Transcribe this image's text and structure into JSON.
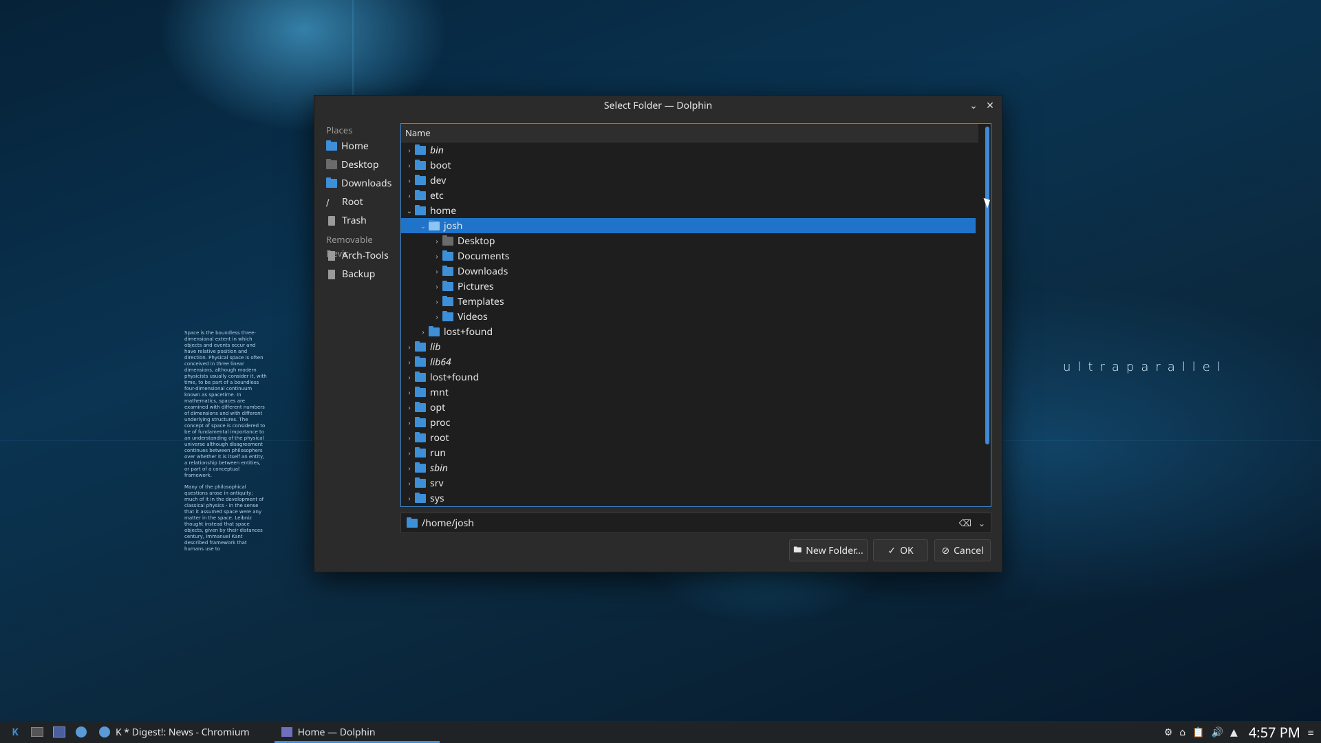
{
  "wallpaper": {
    "text": "ultraparallel",
    "paragraph1": "Space is the boundless three-dimensional extent in which objects and events occur and have relative position and direction. Physical space is often conceived in three linear dimensions, although modern physicists usually consider it, with time, to be part of a boundless four-dimensional continuum known as spacetime. In mathematics, spaces are examined with different numbers of dimensions and with different underlying structures. The concept of space is considered to be of fundamental importance to an understanding of the physical universe although disagreement continues between philosophers over whether it is itself an entity, a relationship between entities, or part of a conceptual framework.",
    "paragraph2": "Many of the philosophical questions arose in antiquity; much of it in the development of classical physics - in the sense that it assumed space were any matter in the space. Leibniz thought instead that space objects, given by their distances century, Immanuel Kant described framework that humans use to"
  },
  "dialog": {
    "title": "Select Folder — Dolphin",
    "places_header": "Places",
    "places": [
      {
        "label": "Home",
        "icon": "home-folder-icon"
      },
      {
        "label": "Desktop",
        "icon": "desktop-icon"
      },
      {
        "label": "Downloads",
        "icon": "downloads-folder-icon"
      },
      {
        "label": "Root",
        "icon": "root-icon"
      },
      {
        "label": "Trash",
        "icon": "trash-icon"
      }
    ],
    "removable_header": "Removable Devic",
    "devices": [
      {
        "label": "Arch-Tools",
        "icon": "drive-icon"
      },
      {
        "label": "Backup",
        "icon": "drive-icon"
      }
    ],
    "column_header": "Name",
    "tree": [
      {
        "label": "bin",
        "level": 0,
        "arrow": "›",
        "italic": true
      },
      {
        "label": "boot",
        "level": 0,
        "arrow": "›"
      },
      {
        "label": "dev",
        "level": 0,
        "arrow": "›"
      },
      {
        "label": "etc",
        "level": 0,
        "arrow": "›"
      },
      {
        "label": "home",
        "level": 0,
        "arrow": "⌄"
      },
      {
        "label": "josh",
        "level": 1,
        "arrow": "⌄",
        "selected": true
      },
      {
        "label": "Desktop",
        "level": 2,
        "arrow": "›",
        "grey": true
      },
      {
        "label": "Documents",
        "level": 2,
        "arrow": "›"
      },
      {
        "label": "Downloads",
        "level": 2,
        "arrow": "›"
      },
      {
        "label": "Pictures",
        "level": 2,
        "arrow": "›"
      },
      {
        "label": "Templates",
        "level": 2,
        "arrow": "›"
      },
      {
        "label": "Videos",
        "level": 2,
        "arrow": "›"
      },
      {
        "label": "lost+found",
        "level": 1,
        "arrow": "›"
      },
      {
        "label": "lib",
        "level": 0,
        "arrow": "›",
        "italic": true
      },
      {
        "label": "lib64",
        "level": 0,
        "arrow": "›",
        "italic": true
      },
      {
        "label": "lost+found",
        "level": 0,
        "arrow": "›"
      },
      {
        "label": "mnt",
        "level": 0,
        "arrow": "›"
      },
      {
        "label": "opt",
        "level": 0,
        "arrow": "›"
      },
      {
        "label": "proc",
        "level": 0,
        "arrow": "›"
      },
      {
        "label": "root",
        "level": 0,
        "arrow": "›"
      },
      {
        "label": "run",
        "level": 0,
        "arrow": "›"
      },
      {
        "label": "sbin",
        "level": 0,
        "arrow": "›",
        "italic": true
      },
      {
        "label": "srv",
        "level": 0,
        "arrow": "›"
      },
      {
        "label": "sys",
        "level": 0,
        "arrow": "›"
      }
    ],
    "path": "/home/josh",
    "buttons": {
      "new_folder": "New Folder...",
      "ok": "OK",
      "cancel": "Cancel"
    }
  },
  "taskbar": {
    "tasks": [
      {
        "label": "K * Digest!: News - Chromium",
        "active": false
      },
      {
        "label": "Home — Dolphin",
        "active": true
      }
    ],
    "clock": "4:57 PM"
  },
  "colors": {
    "accent": "#1f73c9",
    "dialog_bg": "#2b2b2b",
    "folder": "#3d8fd8"
  }
}
